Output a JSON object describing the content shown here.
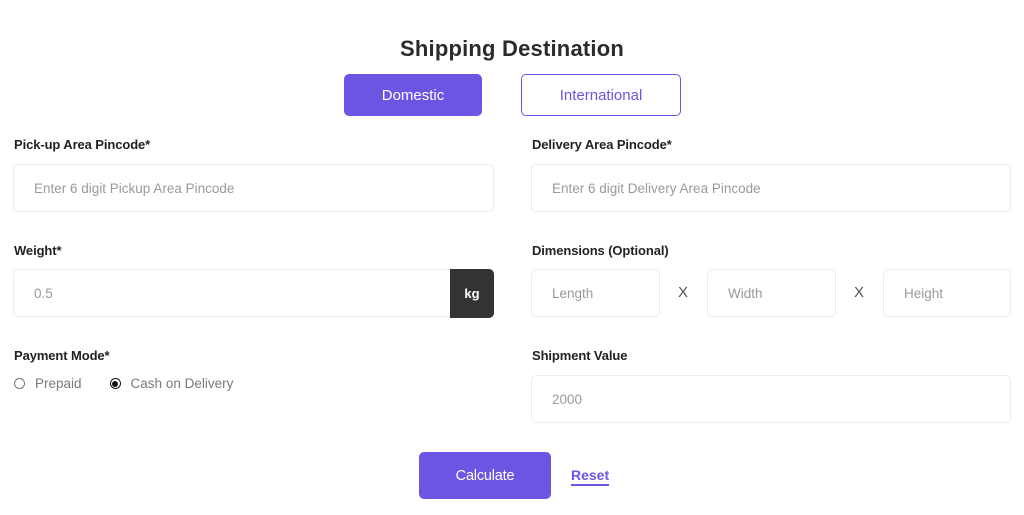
{
  "header": {
    "title": "Shipping Destination"
  },
  "destination_toggle": {
    "options": [
      {
        "label": "Domestic",
        "selected": true
      },
      {
        "label": "International",
        "selected": false
      }
    ]
  },
  "form": {
    "pickup": {
      "label": "Pick-up Area Pincode*",
      "placeholder": "Enter 6 digit Pickup Area Pincode",
      "value": ""
    },
    "delivery": {
      "label": "Delivery Area Pincode*",
      "placeholder": "Enter 6 digit Delivery Area Pincode",
      "value": ""
    },
    "weight": {
      "label": "Weight*",
      "placeholder": "0.5",
      "value": "",
      "unit": "kg"
    },
    "dimensions": {
      "label": "Dimensions (Optional)",
      "separator": "X",
      "length_placeholder": "Length",
      "width_placeholder": "Width",
      "height_placeholder": "Height"
    },
    "payment": {
      "label": "Payment Mode*",
      "options": [
        {
          "label": "Prepaid",
          "checked": false
        },
        {
          "label": "Cash on Delivery",
          "checked": true
        }
      ]
    },
    "shipment_value": {
      "label": "Shipment Value",
      "placeholder": "2000",
      "value": ""
    }
  },
  "actions": {
    "calculate_label": "Calculate",
    "reset_label": "Reset"
  },
  "colors": {
    "accent": "#6c55e3",
    "unit_badge": "#333333"
  }
}
